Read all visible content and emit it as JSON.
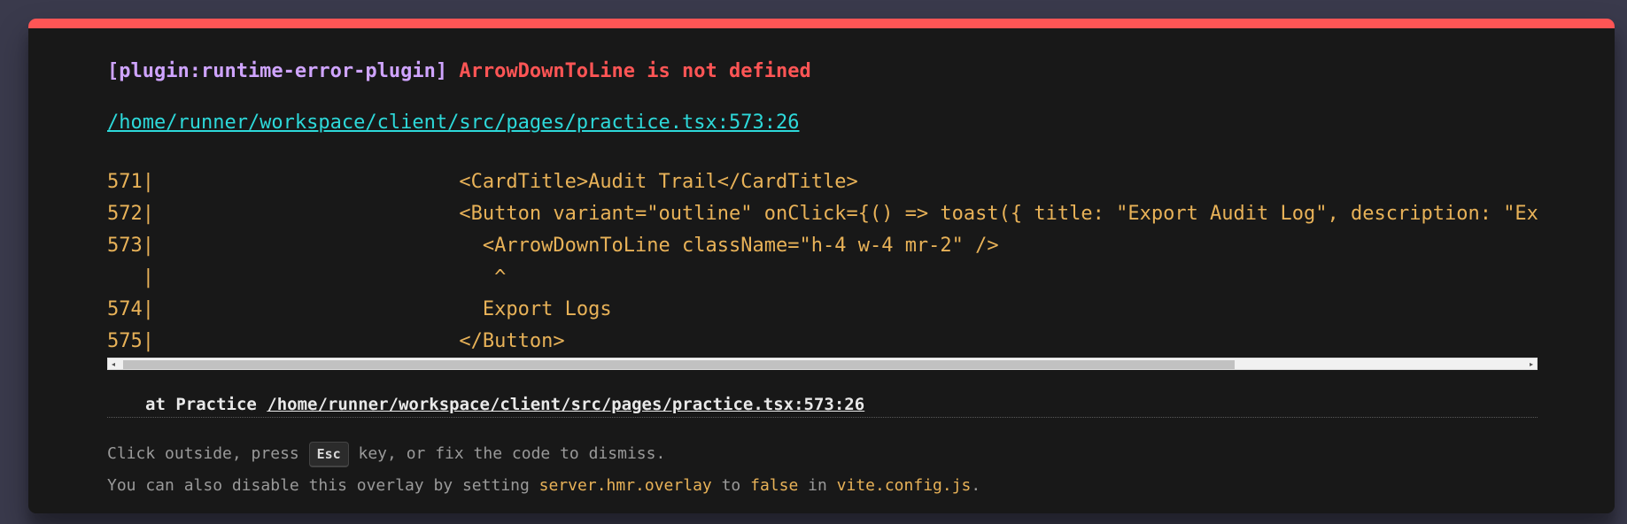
{
  "error": {
    "plugin": "[plugin:runtime-error-plugin]",
    "message": "ArrowDownToLine is not defined",
    "file": "/home/runner/workspace/client/src/pages/practice.tsx:573:26"
  },
  "frame": {
    "lines": [
      {
        "number": "571",
        "code": "                          <CardTitle>Audit Trail</CardTitle>"
      },
      {
        "number": "572",
        "code": "                          <Button variant=\"outline\" onClick={() => toast({ title: \"Export Audit Log\", description: \"Expor"
      },
      {
        "number": "573",
        "code": "                            <ArrowDownToLine className=\"h-4 w-4 mr-2\" />"
      },
      {
        "number": "   ",
        "code": "                             ^"
      },
      {
        "number": "574",
        "code": "                            Export Logs"
      },
      {
        "number": "575",
        "code": "                          </Button>"
      }
    ]
  },
  "stack": {
    "prefix": "at Practice ",
    "link": "/home/runner/workspace/client/src/pages/practice.tsx:573:26"
  },
  "tip": {
    "line1_a": "Click outside, press ",
    "key": "Esc",
    "line1_b": " key, or fix the code to dismiss.",
    "line2_a": "You can also disable this overlay by setting ",
    "setting": "server.hmr.overlay",
    "line2_b": " to ",
    "value": "false",
    "line2_c": " in ",
    "config": "vite.config.js",
    "line2_d": "."
  },
  "scrollbar": {
    "left_arrow": "◂",
    "right_arrow": "▸"
  },
  "colors": {
    "accent": "#ff5555",
    "plugin": "#cfa4ff",
    "link": "#2dd9da",
    "code": "#e8b258",
    "background": "#181818"
  }
}
